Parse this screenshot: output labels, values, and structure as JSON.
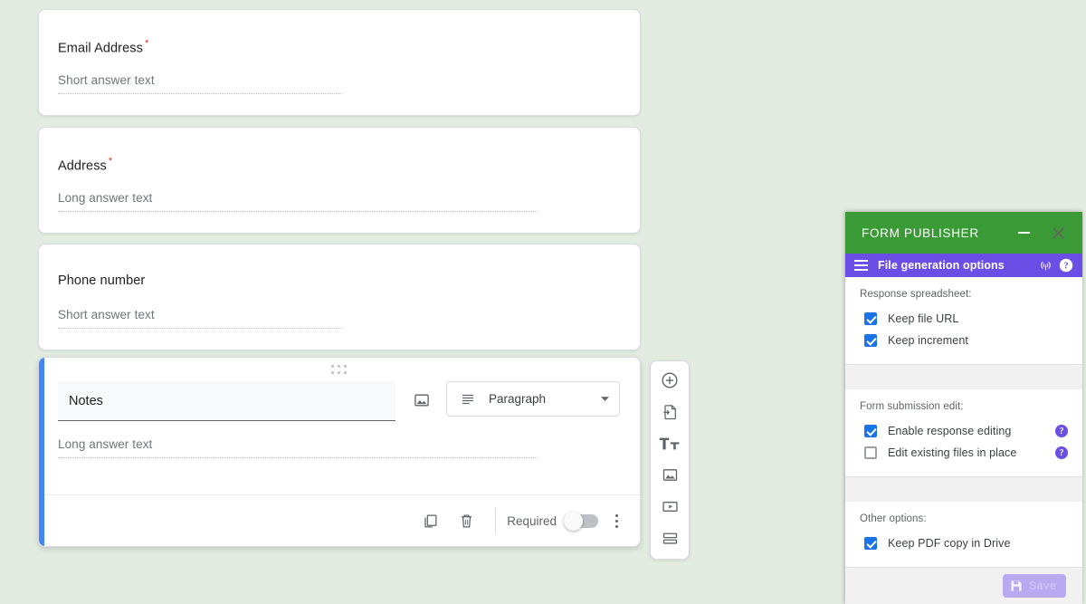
{
  "form": {
    "questions": [
      {
        "title": "Email Address",
        "required": true,
        "answer_hint": "Short answer text",
        "type": "short"
      },
      {
        "title": "Address",
        "required": true,
        "answer_hint": "Long answer text",
        "type": "long"
      },
      {
        "title": "Phone number",
        "required": false,
        "answer_hint": "Short answer text",
        "type": "short"
      }
    ],
    "selected_question": {
      "title": "Notes",
      "answer_hint": "Long answer text",
      "question_type": "Paragraph",
      "required_label": "Required",
      "required_on": false
    },
    "required_marker": "*"
  },
  "side_toolbar": {
    "items": [
      {
        "icon": "add-question-icon"
      },
      {
        "icon": "import-questions-icon"
      },
      {
        "icon": "add-title-icon"
      },
      {
        "icon": "add-image-icon"
      },
      {
        "icon": "add-video-icon"
      },
      {
        "icon": "add-section-icon"
      }
    ]
  },
  "addon": {
    "title": "FORM PUBLISHER",
    "subbar_title": "File generation options",
    "sections": [
      {
        "label": "Response spreadsheet:",
        "options": [
          {
            "text": "Keep file URL",
            "checked": true,
            "help": false
          },
          {
            "text": "Keep increment",
            "checked": true,
            "help": false
          }
        ]
      },
      {
        "label": "Form submission edit:",
        "options": [
          {
            "text": "Enable response editing",
            "checked": true,
            "help": true
          },
          {
            "text": "Edit existing files in place",
            "checked": false,
            "help": true
          }
        ]
      },
      {
        "label": "Other options:",
        "options": [
          {
            "text": "Keep PDF copy in Drive",
            "checked": true,
            "help": false
          }
        ]
      }
    ],
    "save_label": "Save",
    "help_glyph": "?",
    "colors": {
      "title_bar": "#3a9a35",
      "sub_bar": "#6b4ee6",
      "checkbox": "#1a73e8",
      "help": "#6b4ee6",
      "save_button": "#b9a9f0"
    }
  },
  "page": {
    "background": "#e3ece1",
    "accent": "#4285f4"
  }
}
